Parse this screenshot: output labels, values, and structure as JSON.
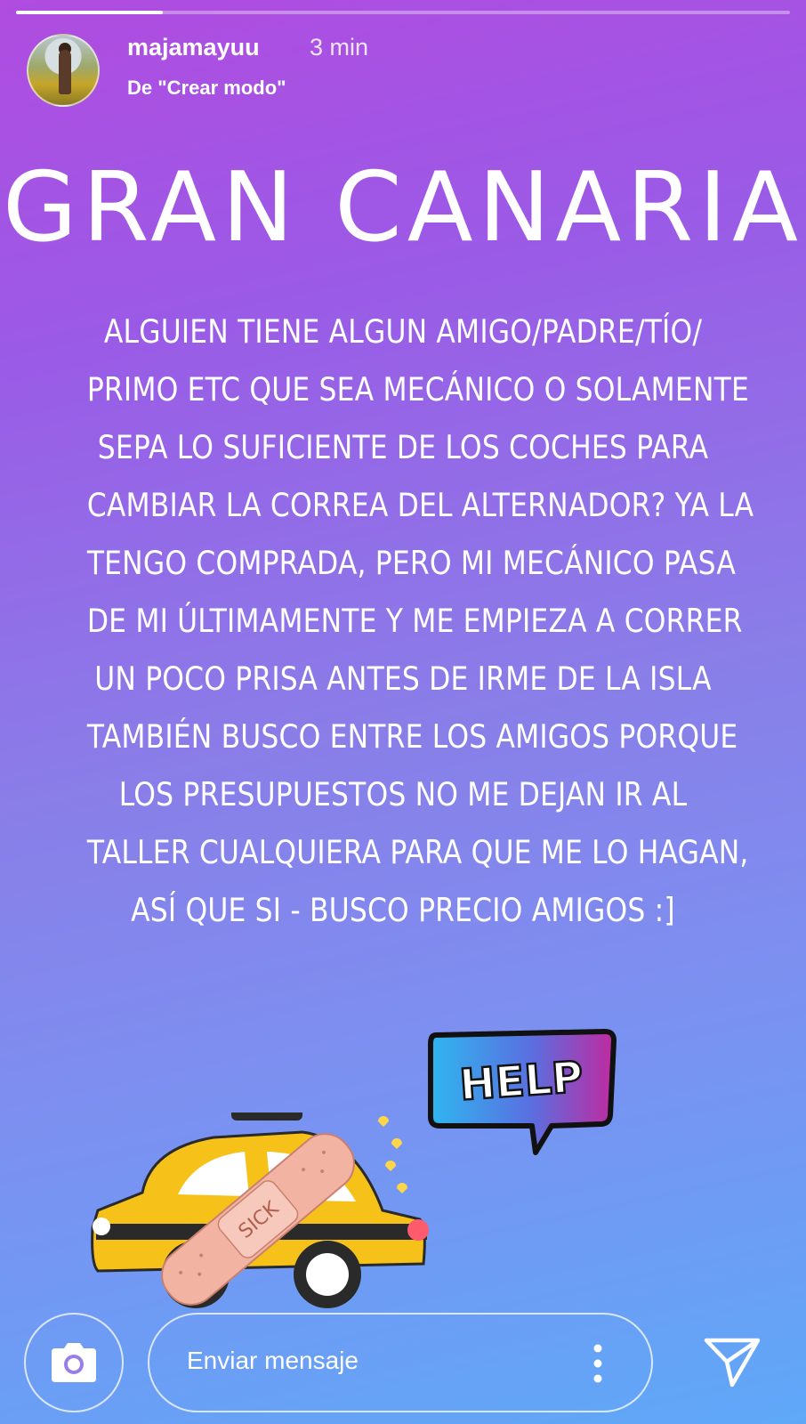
{
  "header": {
    "progress": 0.19,
    "username": "majamayuu",
    "timestamp": "3 min",
    "source": "De \"Crear modo\""
  },
  "story": {
    "title": "GRAN CANARIA",
    "lines": [
      "ALGUIEN TIENE ALGUN AMIGO/PADRE/TÍO/",
      "PRIMO ETC QUE SEA MECÁNICO O SOLAMENTE",
      "SEPA LO SUFICIENTE DE LOS COCHES PARA",
      "CAMBIAR LA CORREA DEL ALTERNADOR? YA LA",
      "TENGO COMPRADA, PERO MI MECÁNICO PASA",
      "DE MI ÚLTIMAMENTE Y ME EMPIEZA A CORRER",
      "UN POCO PRISA ANTES DE IRME DE LA ISLA",
      "TAMBIÉN BUSCO ENTRE LOS AMIGOS PORQUE",
      "LOS PRESUPUESTOS NO ME DEJAN IR AL",
      "TALLER CUALQUIERA PARA QUE ME LO HAGAN,",
      "ASÍ QUE SI - BUSCO PRECIO AMIGOS :]"
    ]
  },
  "stickers": {
    "help_text": "HELP",
    "bandage_text": "SICK",
    "help_icon": "help-speech-bubble",
    "taxi_icon": "sick-taxi"
  },
  "footer": {
    "message_placeholder": "Enviar mensaje",
    "camera_icon": "camera-icon",
    "more_icon": "more-vertical-icon",
    "send_icon": "send-icon"
  }
}
